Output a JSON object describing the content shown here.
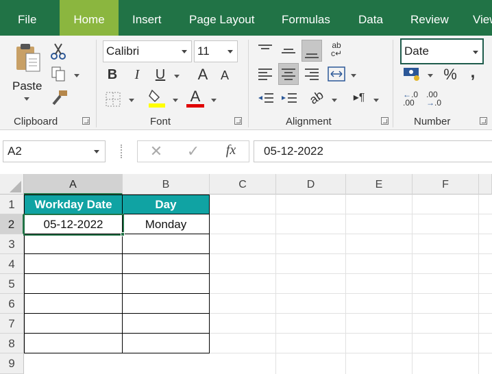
{
  "tabs": [
    {
      "label": "File",
      "active": false
    },
    {
      "label": "Home",
      "active": true
    },
    {
      "label": "Insert",
      "active": false
    },
    {
      "label": "Page Layout",
      "active": false
    },
    {
      "label": "Formulas",
      "active": false
    },
    {
      "label": "Data",
      "active": false
    },
    {
      "label": "Review",
      "active": false
    },
    {
      "label": "View",
      "active": false
    }
  ],
  "clipboard": {
    "label": "Clipboard",
    "paste_label": "Paste"
  },
  "font": {
    "label": "Font",
    "font_name": "Calibri",
    "font_size": "11"
  },
  "alignment": {
    "label": "Alignment"
  },
  "number": {
    "label": "Number",
    "format": "Date",
    "decrease_decimal": ".0",
    "increase_decimal": ".00"
  },
  "formula_bar": {
    "name_box": "A2",
    "content": "05-12-2022",
    "fx": "fx"
  },
  "columns": [
    "A",
    "B",
    "C",
    "D",
    "E",
    "F"
  ],
  "rows": [
    "1",
    "2",
    "3",
    "4",
    "5",
    "6",
    "7",
    "8",
    "9"
  ],
  "cells": {
    "A1": "Workday Date",
    "B1": "Day",
    "A2": "05-12-2022",
    "B2": "Monday"
  },
  "colors": {
    "ribbon_green": "#217346",
    "active_tab": "#8bb63f",
    "header_teal": "#10a3a3"
  }
}
